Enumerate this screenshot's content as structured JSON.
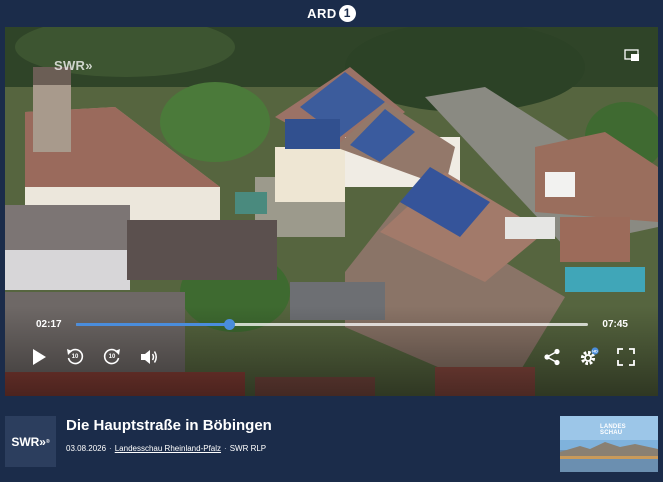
{
  "header": {
    "brand": "ARD",
    "brand_badge": "1"
  },
  "player": {
    "watermark": "SWR»",
    "current_time": "02:17",
    "total_time": "07:45",
    "progress": 0.298,
    "skip_back_seconds": "10",
    "skip_forward_seconds": "10",
    "settings_badge": "HD",
    "icons": [
      "play-icon",
      "skip-back-icon",
      "skip-forward-icon",
      "volume-icon",
      "share-icon",
      "settings-icon",
      "fullscreen-icon",
      "picture-in-picture-icon"
    ]
  },
  "video_info": {
    "channel_logo": "SWR»",
    "title": "Die Hauptstraße in Böbingen",
    "date": "03.08.2026",
    "separator": "·",
    "show_link": "Landesschau Rheinland-Pfalz",
    "broadcaster": "SWR RLP",
    "thumbnail_label_1": "LANDES",
    "thumbnail_label_2": "SCHAU"
  },
  "colors": {
    "background": "#1b2c4a",
    "progress_accent": "#4a8ddc"
  }
}
